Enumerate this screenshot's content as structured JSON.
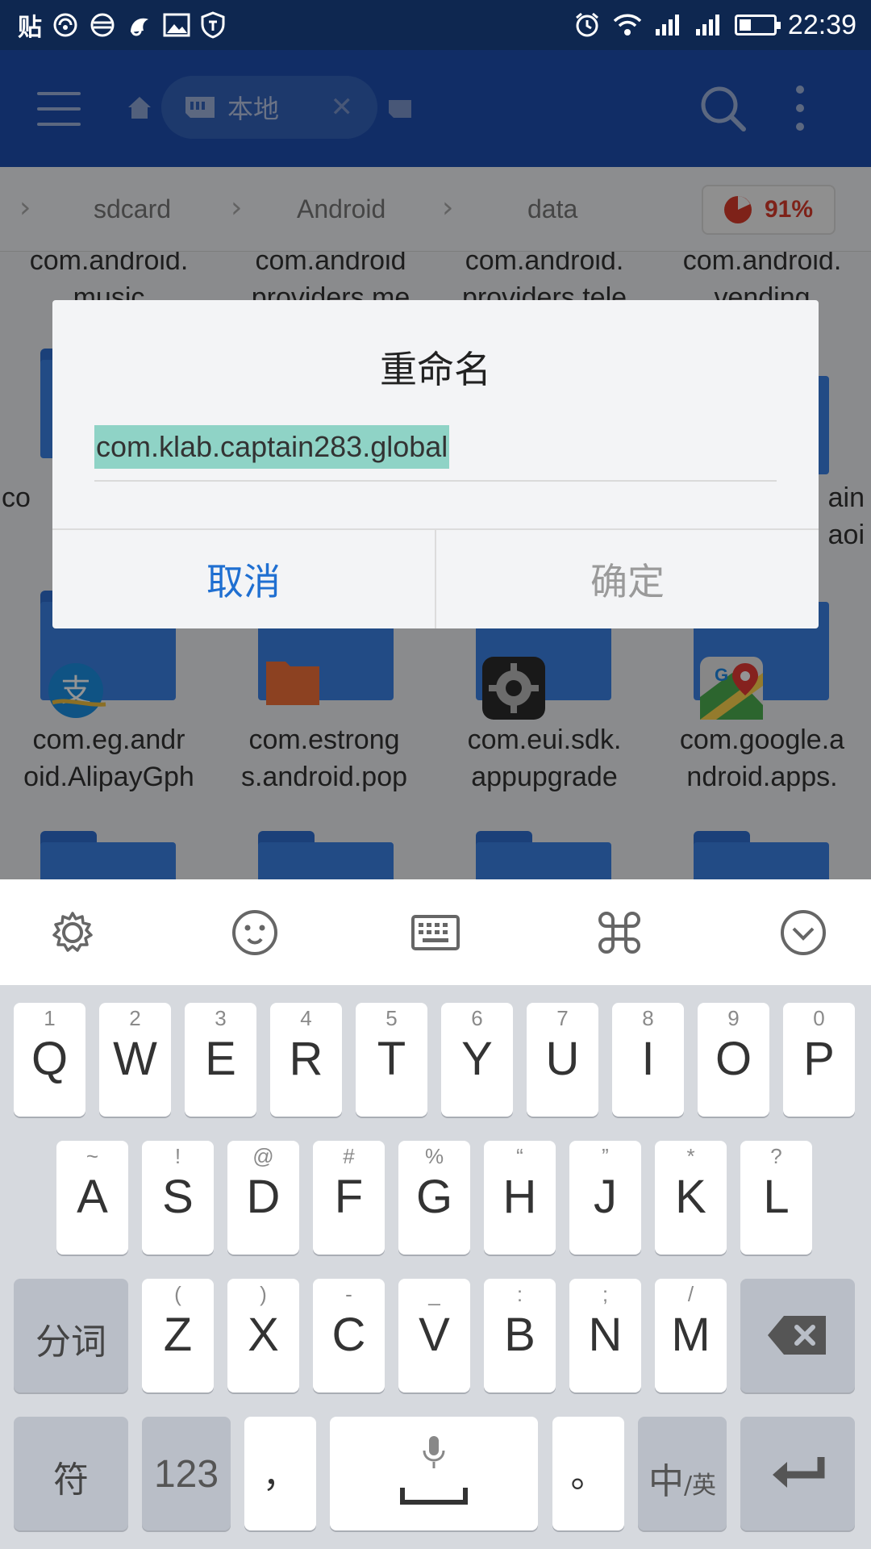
{
  "status_bar": {
    "left_icons": [
      "贴",
      "sync-icon",
      "browser-icon",
      "notification-icon",
      "gallery-icon",
      "shield-icon"
    ],
    "left_text": "贴",
    "time": "22:39"
  },
  "app_bar": {
    "tab_label": "本地"
  },
  "breadcrumb": {
    "items": [
      "sdcard",
      "Android",
      "data"
    ],
    "usage": "91%"
  },
  "files": {
    "row1": [
      "com.android.\nmusic",
      "com.android\nproviders.me",
      "com.android.\nproviders.tele",
      "com.android.\nvending"
    ],
    "row2_left": "co",
    "row2_right": "ain\naoi",
    "row3": [
      "com.eg.andr\noid.AlipayGph",
      "com.estrong\ns.android.pop",
      "com.eui.sdk.\nappupgrade",
      "com.google.a\nndroid.apps."
    ]
  },
  "dialog": {
    "title": "重命名",
    "input_value": "com.klab.captain283.global",
    "cancel_label": "取消",
    "ok_label": "确定"
  },
  "keyboard": {
    "row1": [
      {
        "hint": "1",
        "key": "Q"
      },
      {
        "hint": "2",
        "key": "W"
      },
      {
        "hint": "3",
        "key": "E"
      },
      {
        "hint": "4",
        "key": "R"
      },
      {
        "hint": "5",
        "key": "T"
      },
      {
        "hint": "6",
        "key": "Y"
      },
      {
        "hint": "7",
        "key": "U"
      },
      {
        "hint": "8",
        "key": "I"
      },
      {
        "hint": "9",
        "key": "O"
      },
      {
        "hint": "0",
        "key": "P"
      }
    ],
    "row2": [
      {
        "hint": "~",
        "key": "A"
      },
      {
        "hint": "!",
        "key": "S"
      },
      {
        "hint": "@",
        "key": "D"
      },
      {
        "hint": "#",
        "key": "F"
      },
      {
        "hint": "%",
        "key": "G"
      },
      {
        "hint": "“",
        "key": "H"
      },
      {
        "hint": "”",
        "key": "J"
      },
      {
        "hint": "*",
        "key": "K"
      },
      {
        "hint": "?",
        "key": "L"
      }
    ],
    "row3": [
      {
        "hint": "(",
        "key": "Z"
      },
      {
        "hint": ")",
        "key": "X"
      },
      {
        "hint": "-",
        "key": "C"
      },
      {
        "hint": "_",
        "key": "V"
      },
      {
        "hint": ":",
        "key": "B"
      },
      {
        "hint": ";",
        "key": "N"
      },
      {
        "hint": "/",
        "key": "M"
      }
    ],
    "segment_label": "分词",
    "symbol_label": "符",
    "number_label": "123",
    "comma_label": "，",
    "period_label": "。",
    "lang_main": "中",
    "lang_sub": "/英"
  }
}
